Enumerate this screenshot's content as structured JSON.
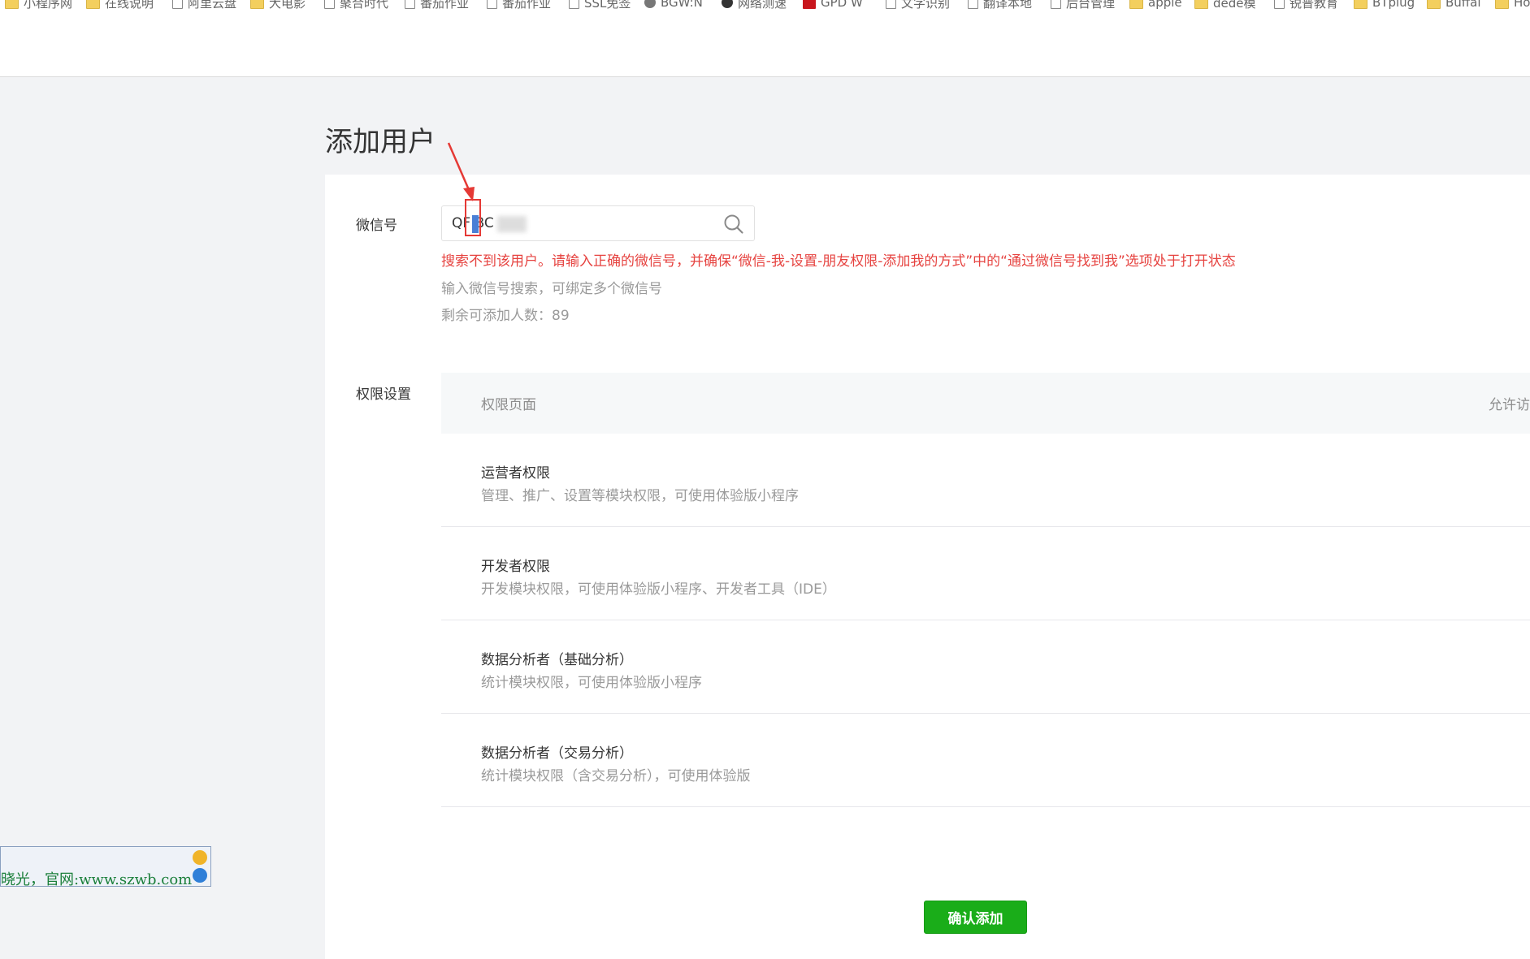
{
  "bookmarks": [
    {
      "label": "小程序网",
      "icon": "folder-icon"
    },
    {
      "label": "在线说明",
      "icon": "folder-icon"
    },
    {
      "label": "阿里云盘",
      "icon": "page-icon"
    },
    {
      "label": "大电影",
      "icon": "folder-icon"
    },
    {
      "label": "聚合时代",
      "icon": "page-icon"
    },
    {
      "label": "番茄作业",
      "icon": "page-icon"
    },
    {
      "label": "番茄作业",
      "icon": "page-icon"
    },
    {
      "label": "SSL免签",
      "icon": "page-icon"
    },
    {
      "label": "BGW:N",
      "icon": "gear-icon"
    },
    {
      "label": "网络测速",
      "icon": "globe-icon"
    },
    {
      "label": "GPD W",
      "icon": "jd-icon"
    },
    {
      "label": "文字识别",
      "icon": "page-icon"
    },
    {
      "label": "翻译本地",
      "icon": "page-icon"
    },
    {
      "label": "后台管理",
      "icon": "page-icon"
    },
    {
      "label": "apple",
      "icon": "folder-icon"
    },
    {
      "label": "dede模",
      "icon": "folder-icon"
    },
    {
      "label": "锐普教育",
      "icon": "page-icon"
    },
    {
      "label": "BTplug",
      "icon": "folder-icon"
    },
    {
      "label": "Buffal",
      "icon": "folder-icon"
    },
    {
      "label": "Ho",
      "icon": "folder-icon"
    }
  ],
  "page": {
    "title": "添加用户"
  },
  "wechat": {
    "label": "微信号",
    "value": "QF BC",
    "error": "搜索不到该用户。请输入正确的微信号，并确保“微信-我-设置-朋友权限-添加我的方式”中的“通过微信号找到我”选项处于打开状态",
    "help": "输入微信号搜索，可绑定多个微信号",
    "remaining": "剩余可添加人数：89"
  },
  "permissions": {
    "label": "权限设置",
    "header_page": "权限页面",
    "header_allow": "允许访",
    "rows": [
      {
        "title": "运营者权限",
        "desc": "管理、推广、设置等模块权限，可使用体验版小程序"
      },
      {
        "title": "开发者权限",
        "desc": "开发模块权限，可使用体验版小程序、开发者工具（IDE）"
      },
      {
        "title": "数据分析者（基础分析）",
        "desc": "统计模块权限，可使用体验版小程序"
      },
      {
        "title": "数据分析者（交易分析）",
        "desc": "统计模块权限（含交易分析），可使用体验版"
      }
    ]
  },
  "actions": {
    "confirm": "确认添加"
  },
  "ime": {
    "text": "晓光，官网:www.szwb.com"
  },
  "colors": {
    "accent": "#1aad19",
    "error": "#e64340",
    "annotation": "#e53935"
  }
}
